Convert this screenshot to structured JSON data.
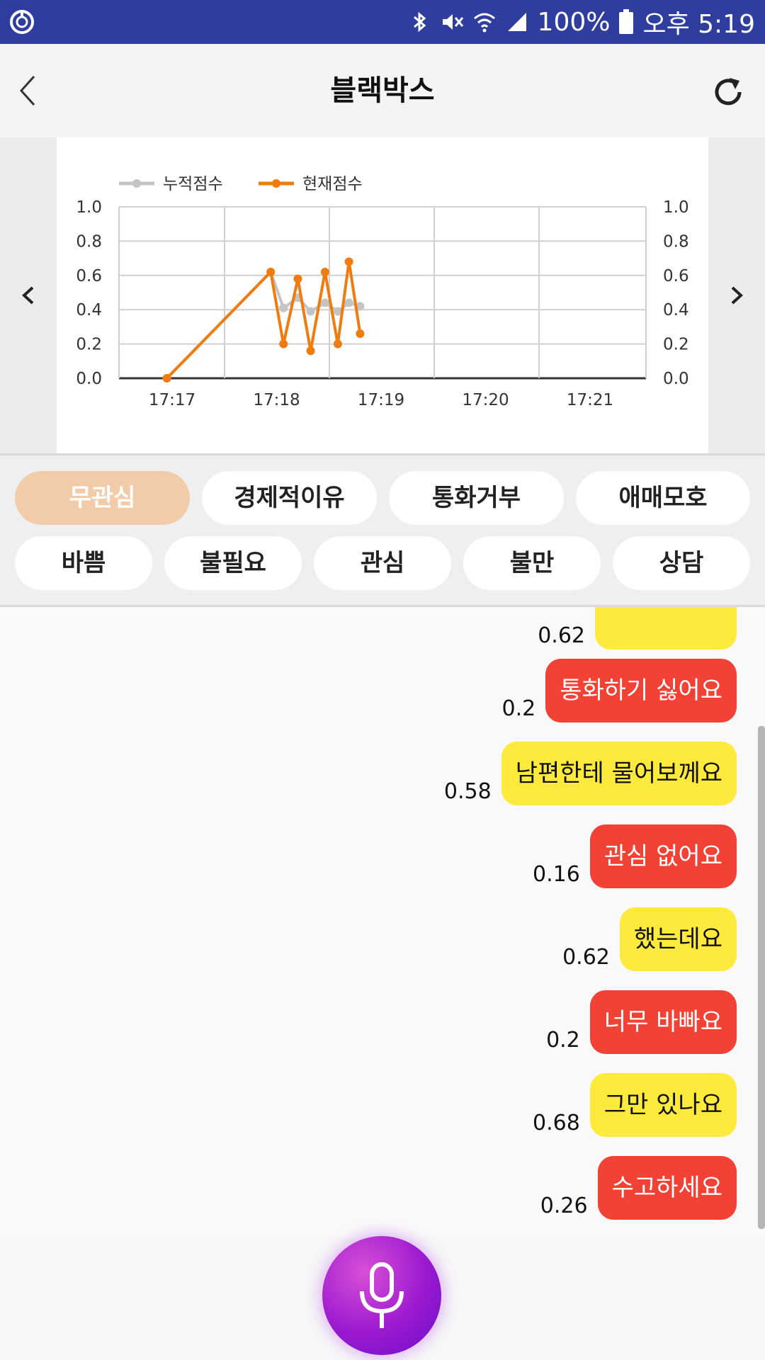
{
  "status_bar": {
    "battery": "100%",
    "time": "오후 5:19",
    "icons": [
      "app-icon",
      "bluetooth-icon",
      "mute-icon",
      "wifi-icon",
      "signal-icon",
      "battery-icon"
    ]
  },
  "header": {
    "title": "블랙박스",
    "icons": [
      "back-icon",
      "refresh-icon"
    ]
  },
  "chart_data": {
    "type": "line",
    "legend": [
      "누적점수",
      "현재점수"
    ],
    "legend_position": "top-left",
    "x_ticks": [
      "17:17",
      "17:18",
      "17:19",
      "17:20",
      "17:21"
    ],
    "ylim": [
      0,
      1
    ],
    "y_ticks": [
      "0.0",
      "0.2",
      "0.4",
      "0.6",
      "0.8",
      "1.0"
    ],
    "y_ticks_right": [
      "0.0",
      "0.2",
      "0.4",
      "0.6",
      "0.8",
      "1.0"
    ],
    "grid": true,
    "series": [
      {
        "name": "누적점수",
        "color": "#c4c4c4",
        "x": [
          "17:16:30",
          "17:17:35",
          "17:17:43",
          "17:17:52",
          "17:18:00",
          "17:18:09",
          "17:18:17",
          "17:18:24",
          "17:18:31"
        ],
        "y": [
          0.0,
          0.62,
          0.41,
          0.47,
          0.39,
          0.44,
          0.39,
          0.44,
          0.42
        ]
      },
      {
        "name": "현재점수",
        "color": "#f07c10",
        "x": [
          "17:16:30",
          "17:17:35",
          "17:17:43",
          "17:17:52",
          "17:18:00",
          "17:18:09",
          "17:18:17",
          "17:18:24",
          "17:18:31"
        ],
        "y": [
          0.0,
          0.62,
          0.2,
          0.58,
          0.16,
          0.62,
          0.2,
          0.68,
          0.26
        ]
      }
    ]
  },
  "categories_row1": [
    {
      "label": "무관심",
      "active": true
    },
    {
      "label": "경제적이유",
      "active": false
    },
    {
      "label": "통화거부",
      "active": false
    },
    {
      "label": "애매모호",
      "active": false
    }
  ],
  "categories_row2": [
    {
      "label": "바쁨"
    },
    {
      "label": "불필요"
    },
    {
      "label": "관심"
    },
    {
      "label": "불만"
    },
    {
      "label": "상담"
    }
  ],
  "messages": [
    {
      "text": "",
      "score": "0.62",
      "color": "yellow"
    },
    {
      "text": "통화하기 싫어요",
      "score": "0.2",
      "color": "red"
    },
    {
      "text": "남편한테 물어보께요",
      "score": "0.58",
      "color": "yellow"
    },
    {
      "text": "관심 없어요",
      "score": "0.16",
      "color": "red"
    },
    {
      "text": "했는데요",
      "score": "0.62",
      "color": "yellow"
    },
    {
      "text": "너무 바빠요",
      "score": "0.2",
      "color": "red"
    },
    {
      "text": "그만 있나요",
      "score": "0.68",
      "color": "yellow"
    },
    {
      "text": "수고하세요",
      "score": "0.26",
      "color": "red"
    }
  ],
  "colors": {
    "accent": "#2f3e9e",
    "red": "#f24236",
    "yellow": "#fdea3c",
    "chip_active": "#f2cba9"
  },
  "mic": {
    "icon": "microphone-icon"
  }
}
